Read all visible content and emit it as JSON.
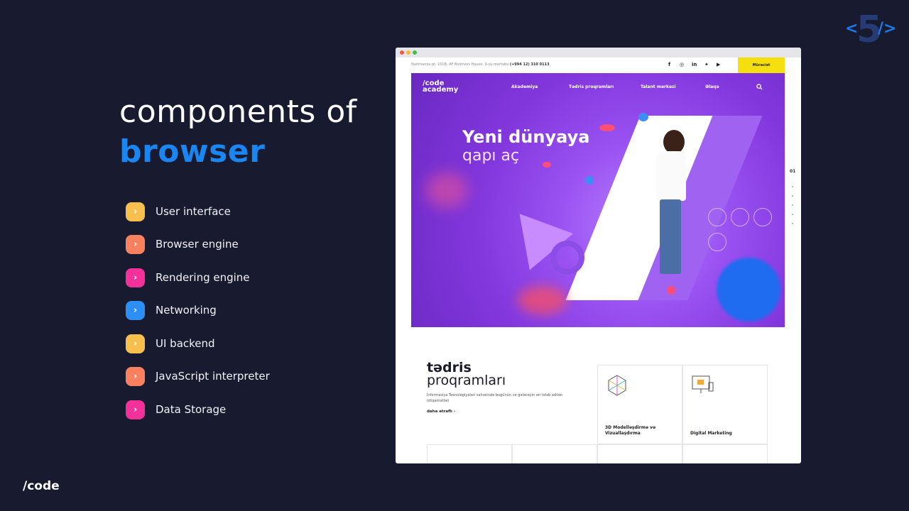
{
  "slide": {
    "title_line1": "components of",
    "title_line2": "browser",
    "brand": "/code",
    "logo": {
      "left": "<",
      "number": "5",
      "right": "/>"
    }
  },
  "components": [
    {
      "label": "User interface",
      "color": "#f7c04e"
    },
    {
      "label": "Browser engine",
      "color": "#f98160"
    },
    {
      "label": "Rendering engine",
      "color": "#f3319a"
    },
    {
      "label": "Networking",
      "color": "#2b8ff6"
    },
    {
      "label": "UI backend",
      "color": "#f7c04e"
    },
    {
      "label": "JavaScript interpreter",
      "color": "#f98160"
    },
    {
      "label": "Data Storage",
      "color": "#f3319a"
    }
  ],
  "chevron": "›",
  "screenshot": {
    "address_text": "Nərimanov pr. 101B, AF Business House, 3-cü mərtəbə",
    "phone": "(+994 12) 310 0113",
    "social": [
      "f",
      "◎",
      "in",
      "✦",
      "▶"
    ],
    "apply_button": "Müraciət",
    "logo_line1": "/code",
    "logo_line2": "academy",
    "nav": [
      "Akademiya",
      "Tədris proqramları",
      "Talant mərkəzi",
      "Əlaqə"
    ],
    "hero_title": "Yeni dünyaya",
    "hero_subtitle": "qapı aç",
    "pager": "01",
    "section_title_bold": "tədris",
    "section_title_light": "proqramları",
    "section_desc": "İnformasiya Texnologiyaları sahəsində bugünün və gələcəyin ən tələb edilən istiqamətləri",
    "section_more": "daha ətraflı  ›",
    "cards": [
      {
        "label": "3D Modelləşdirmə və Vizuallaşdırma"
      },
      {
        "label": "Digital Marketing"
      }
    ]
  }
}
